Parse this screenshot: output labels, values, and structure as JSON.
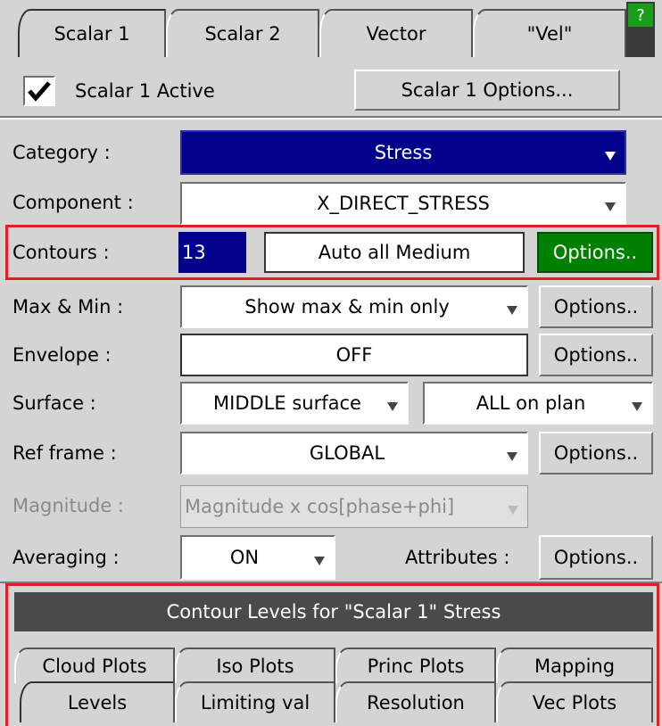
{
  "tabs": [
    "Scalar 1",
    "Scalar 2",
    "Vector",
    "\"Vel\""
  ],
  "help_label": "?",
  "active_checkbox": {
    "label": "Scalar 1 Active",
    "checked": true
  },
  "scalar_options_button": "Scalar 1 Options...",
  "rows": {
    "category": {
      "label": "Category :",
      "value": "Stress"
    },
    "component": {
      "label": "Component :",
      "value": "X_DIRECT_STRESS"
    },
    "contours": {
      "label": "Contours :",
      "count": "13",
      "mode": "Auto all Medium",
      "options": "Options.."
    },
    "maxmin": {
      "label": "Max & Min :",
      "value": "Show max & min only",
      "options": "Options.."
    },
    "envelope": {
      "label": "Envelope :",
      "value": "OFF",
      "options": "Options.."
    },
    "surface": {
      "label": "Surface :",
      "value": "MIDDLE surface",
      "plan": "ALL on plan"
    },
    "refframe": {
      "label": "Ref frame :",
      "value": "GLOBAL",
      "options": "Options.."
    },
    "magnitude": {
      "label": "Magnitude :",
      "value": "Magnitude x cos[phase+phi]"
    },
    "averaging": {
      "label": "Averaging :",
      "value": "ON",
      "attributes_label": "Attributes :",
      "options": "Options.."
    }
  },
  "levels_panel": {
    "title": "Contour Levels for \"Scalar 1\" Stress",
    "tabs_row1": [
      "Cloud Plots",
      "Iso Plots",
      "Princ Plots",
      "Mapping"
    ],
    "tabs_row2": [
      "Levels",
      "Limiting val",
      "Resolution",
      "Vec Plots"
    ]
  },
  "colors": {
    "panel_bg": "#d4d4d4",
    "category_bg": "#00008b",
    "contours_count_bg": "#00008b",
    "options_active_bg": "#008000",
    "highlight_border": "#e02020",
    "levels_title_bg": "#4a4a4a"
  }
}
